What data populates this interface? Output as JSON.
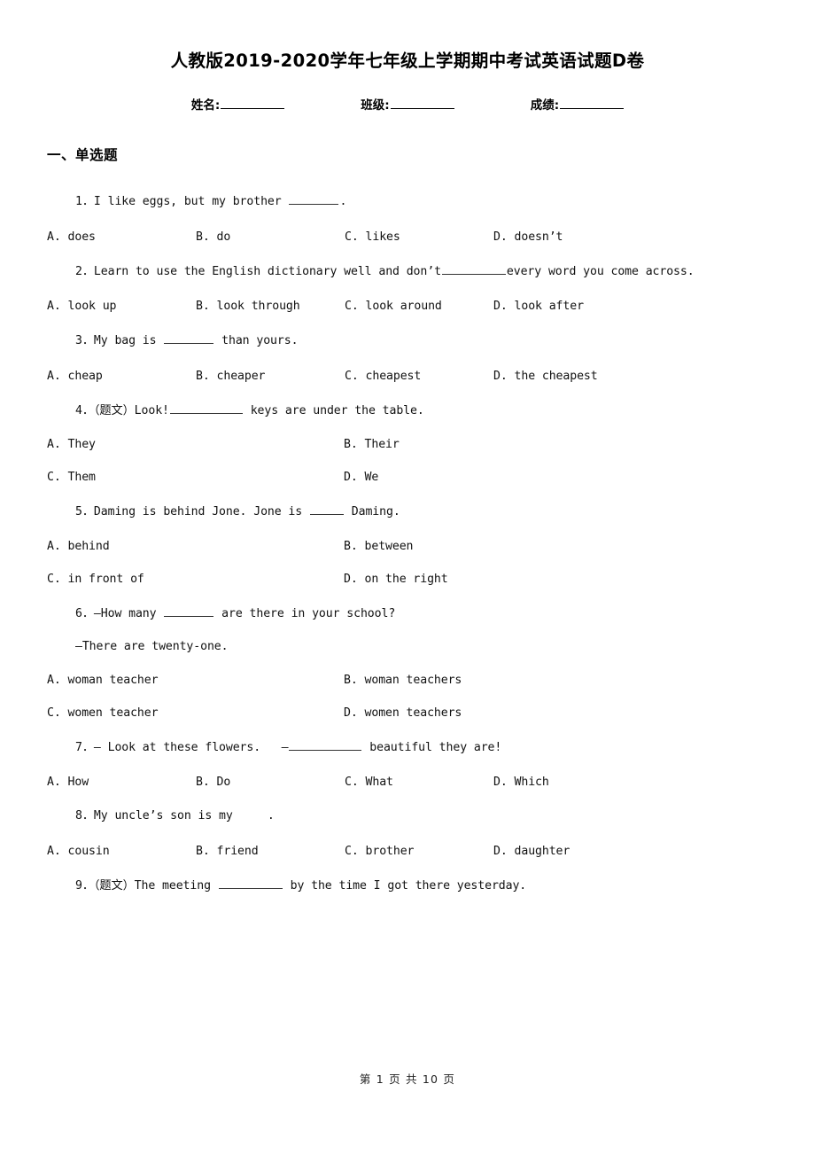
{
  "document": {
    "title": "人教版2019-2020学年七年级上学期期中考试英语试题D卷",
    "fields": [
      {
        "label": "姓名:"
      },
      {
        "label": "班级:"
      },
      {
        "label": "成绩:"
      }
    ],
    "section_heading": "一、单选题",
    "footer": "第 1 页 共 10 页"
  },
  "questions": [
    {
      "stem": "1．I like eggs, but my brother ",
      "stem_tail": ".",
      "blank": "w-md",
      "columns": 4,
      "options": [
        "A. does",
        "B. do",
        "C. likes",
        "D. doesn’t"
      ]
    },
    {
      "stem": "2．Learn to use the English dictionary well and don’t",
      "stem_tail": "every word you come across.",
      "blank": "w-lg",
      "columns": 4,
      "options": [
        "A. look up",
        "B. look through",
        "C. look around",
        "D. look after"
      ]
    },
    {
      "stem": "3．My bag is ",
      "stem_tail": " than yours.",
      "blank": "w-md",
      "columns": 4,
      "options": [
        "A. cheap",
        "B. cheaper",
        "C. cheapest",
        "D. the cheapest"
      ]
    },
    {
      "stem": "4．（题文）Look!",
      "stem_tail": " keys are under the table.",
      "blank": "w-xl",
      "columns": 2,
      "options": [
        "A. They",
        "B. Their",
        "C. Them",
        "D. We"
      ]
    },
    {
      "stem": "5．Daming is behind Jone. Jone is ",
      "stem_tail": " Daming.",
      "blank": "w-sm",
      "columns": 2,
      "options": [
        "A. behind",
        "B. between",
        "C. in front of",
        "D. on the right"
      ]
    },
    {
      "stem": "6．—How many ",
      "stem_tail": " are there in your school?",
      "blank": "w-md",
      "continuation": "—There are twenty-one.",
      "columns": 2,
      "options": [
        "A. woman teacher",
        "B. woman teachers",
        "C. women teacher",
        "D. women teachers"
      ]
    },
    {
      "stem": "7．— Look at these flowers.   —",
      "stem_tail": " beautiful they are!",
      "blank": "w-xl",
      "columns": 4,
      "options": [
        "A. How",
        "B. Do",
        "C. What",
        "D. Which"
      ]
    },
    {
      "stem": "8．My uncle’s son is my ",
      "stem_tail": "    .",
      "blank": "",
      "columns": 4,
      "options": [
        "A. cousin",
        "B. friend",
        "C. brother",
        "D. daughter"
      ]
    },
    {
      "stem": "9．（题文）The meeting ",
      "stem_tail": " by the time I got there yesterday.",
      "blank": "w-lg",
      "columns": 0,
      "options": []
    }
  ]
}
